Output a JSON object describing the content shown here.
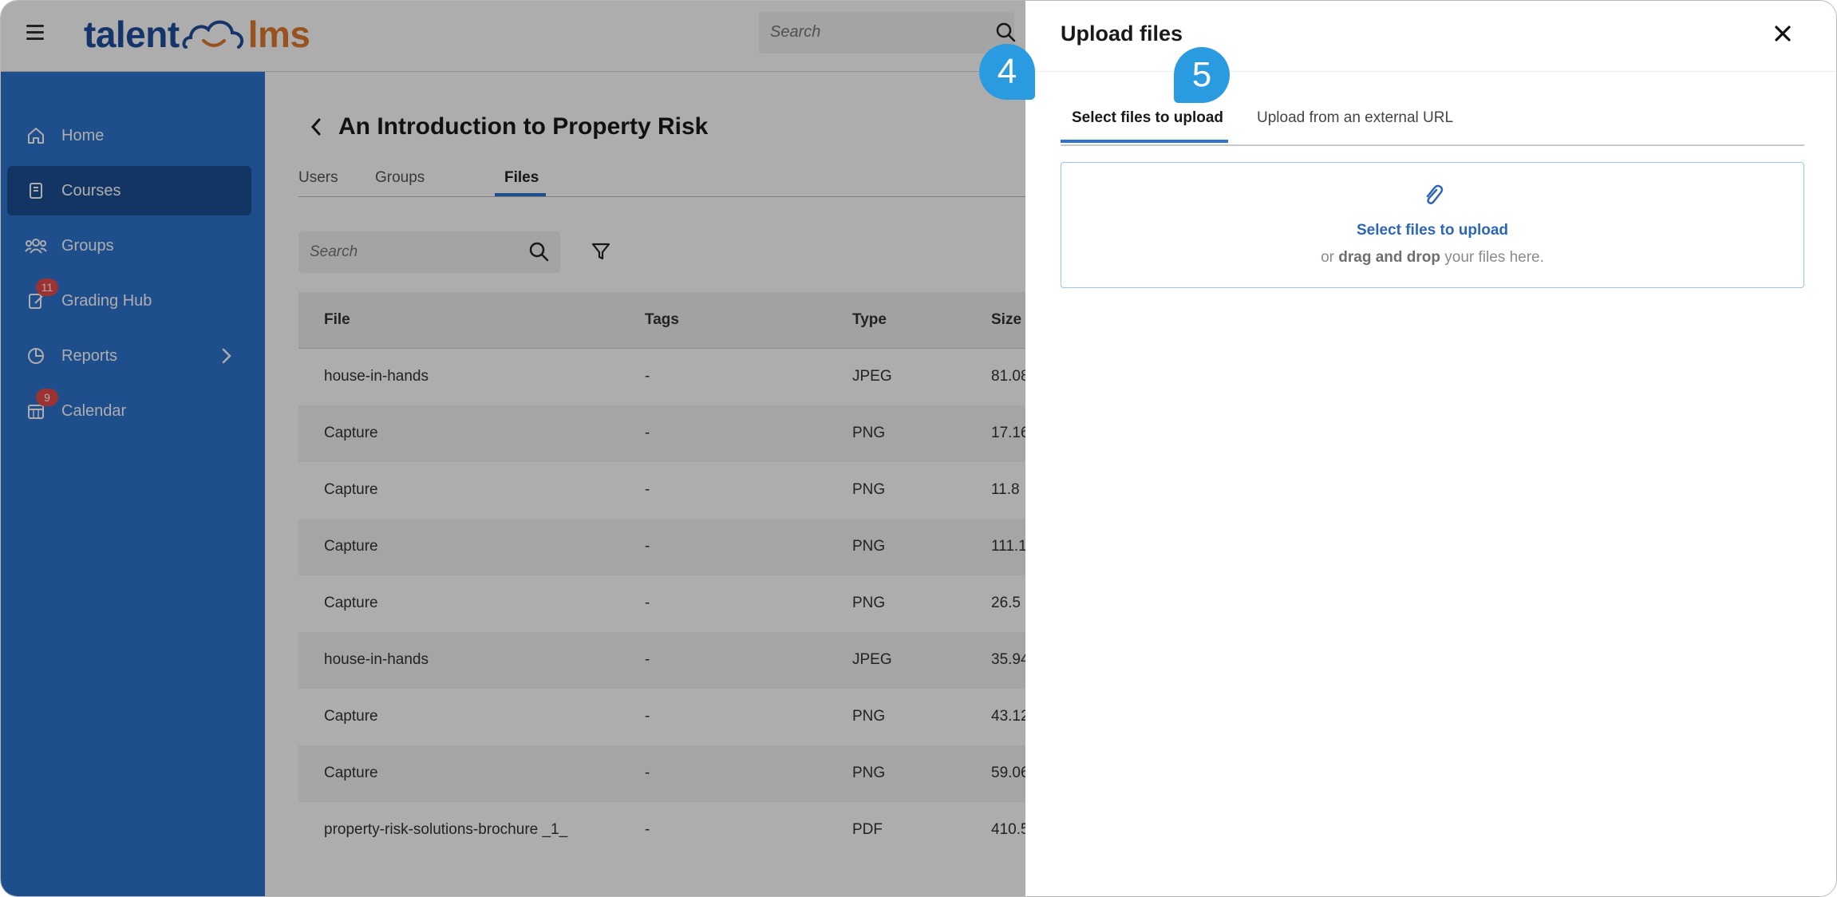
{
  "app": {
    "logo_left": "talent",
    "logo_right": "lms"
  },
  "top_search": {
    "placeholder": "Search"
  },
  "sidebar": {
    "items": [
      {
        "label": "Home",
        "icon": "home-icon"
      },
      {
        "label": "Courses",
        "icon": "book-icon",
        "active": true
      },
      {
        "label": "Groups",
        "icon": "users-icon"
      },
      {
        "label": "Grading Hub",
        "icon": "grading-icon",
        "badge": "11"
      },
      {
        "label": "Reports",
        "icon": "pie-chart-icon",
        "has_chevron": true
      },
      {
        "label": "Calendar",
        "icon": "calendar-icon",
        "badge": "9"
      }
    ]
  },
  "course": {
    "title": "An Introduction to Property Risk",
    "tabs": [
      "Users",
      "Groups",
      "Files"
    ],
    "active_tab": "Files",
    "search_placeholder": "Search"
  },
  "files_table": {
    "columns": [
      "File",
      "Tags",
      "Type",
      "Size"
    ],
    "rows": [
      {
        "file": "house-in-hands",
        "tags": "-",
        "type": "JPEG",
        "size": "81.08"
      },
      {
        "file": "Capture",
        "tags": "-",
        "type": "PNG",
        "size": "17.16"
      },
      {
        "file": "Capture",
        "tags": "-",
        "type": "PNG",
        "size": "11.8"
      },
      {
        "file": "Capture",
        "tags": "-",
        "type": "PNG",
        "size": "111.1"
      },
      {
        "file": "Capture",
        "tags": "-",
        "type": "PNG",
        "size": "26.5"
      },
      {
        "file": "house-in-hands",
        "tags": "-",
        "type": "JPEG",
        "size": "35.94"
      },
      {
        "file": "Capture",
        "tags": "-",
        "type": "PNG",
        "size": "43.12"
      },
      {
        "file": "Capture",
        "tags": "-",
        "type": "PNG",
        "size": "59.06"
      },
      {
        "file": "property-risk-solutions-brochure _1_",
        "tags": "-",
        "type": "PDF",
        "size": "410.5"
      }
    ]
  },
  "upload_panel": {
    "title": "Upload files",
    "tabs": [
      "Select files to upload",
      "Upload from an external URL"
    ],
    "active_tab": "Select files to upload",
    "dropzone_title": "Select files to upload",
    "dropzone_sub_prefix": "or",
    "dropzone_sub_bold": "drag and drop",
    "dropzone_sub_suffix": "your files here."
  },
  "callouts": [
    "4",
    "5"
  ],
  "colors": {
    "sidebar": "#2d73cf",
    "sidebar_active": "#1d4f92",
    "accent": "#2d73cf",
    "callout": "#2a9be0",
    "badge": "#e84a4a"
  }
}
